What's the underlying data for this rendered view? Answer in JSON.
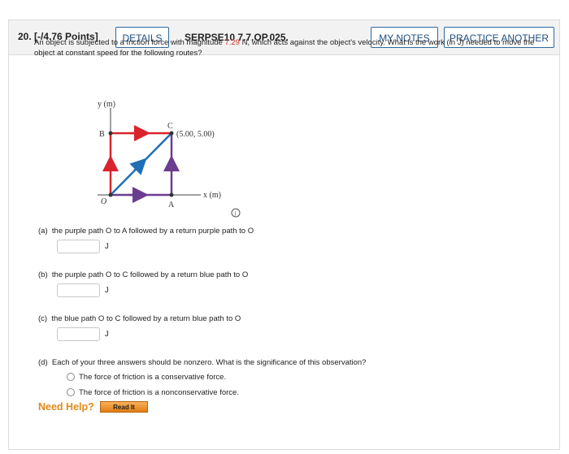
{
  "header": {
    "question_number": "20. [-/4.76 Points]",
    "details_label": "DETAILS",
    "question_code": "SERPSE10 7.7.OP.025.",
    "my_notes_label": "MY NOTES",
    "practice_another_label": "PRACTICE ANOTHER"
  },
  "problem": {
    "text_before": "An object is subjected to a friction force with magnitude ",
    "magnitude": "7.29",
    "text_after": " N, which acts against the object's velocity. What is the work (in J) needed to move the object at constant speed for the following routes?"
  },
  "figure": {
    "y_axis_label": "y (m)",
    "x_axis_label": "x (m)",
    "origin_label": "O",
    "point_a": "A",
    "point_b": "B",
    "point_c": "C",
    "point_c_coords": "(5.00, 5.00)",
    "colors": {
      "red": "#d9232d",
      "blue": "#1f6fb5",
      "purple": "#6a3d8f"
    }
  },
  "parts": [
    {
      "label": "(a)",
      "text": "the purple path O to A followed by a return purple path to O",
      "unit": "J",
      "value": ""
    },
    {
      "label": "(b)",
      "text": "the purple path O to C followed by a return blue path to O",
      "unit": "J",
      "value": ""
    },
    {
      "label": "(c)",
      "text": "the blue path O to C followed by a return blue path to O",
      "unit": "J",
      "value": ""
    }
  ],
  "part_d": {
    "label": "(d)",
    "text": "Each of your three answers should be nonzero. What is the significance of this observation?",
    "options": [
      "The force of friction is a conservative force.",
      "The force of friction is a nonconservative force."
    ]
  },
  "help": {
    "need_help": "Need Help?",
    "read_it": "Read It"
  }
}
